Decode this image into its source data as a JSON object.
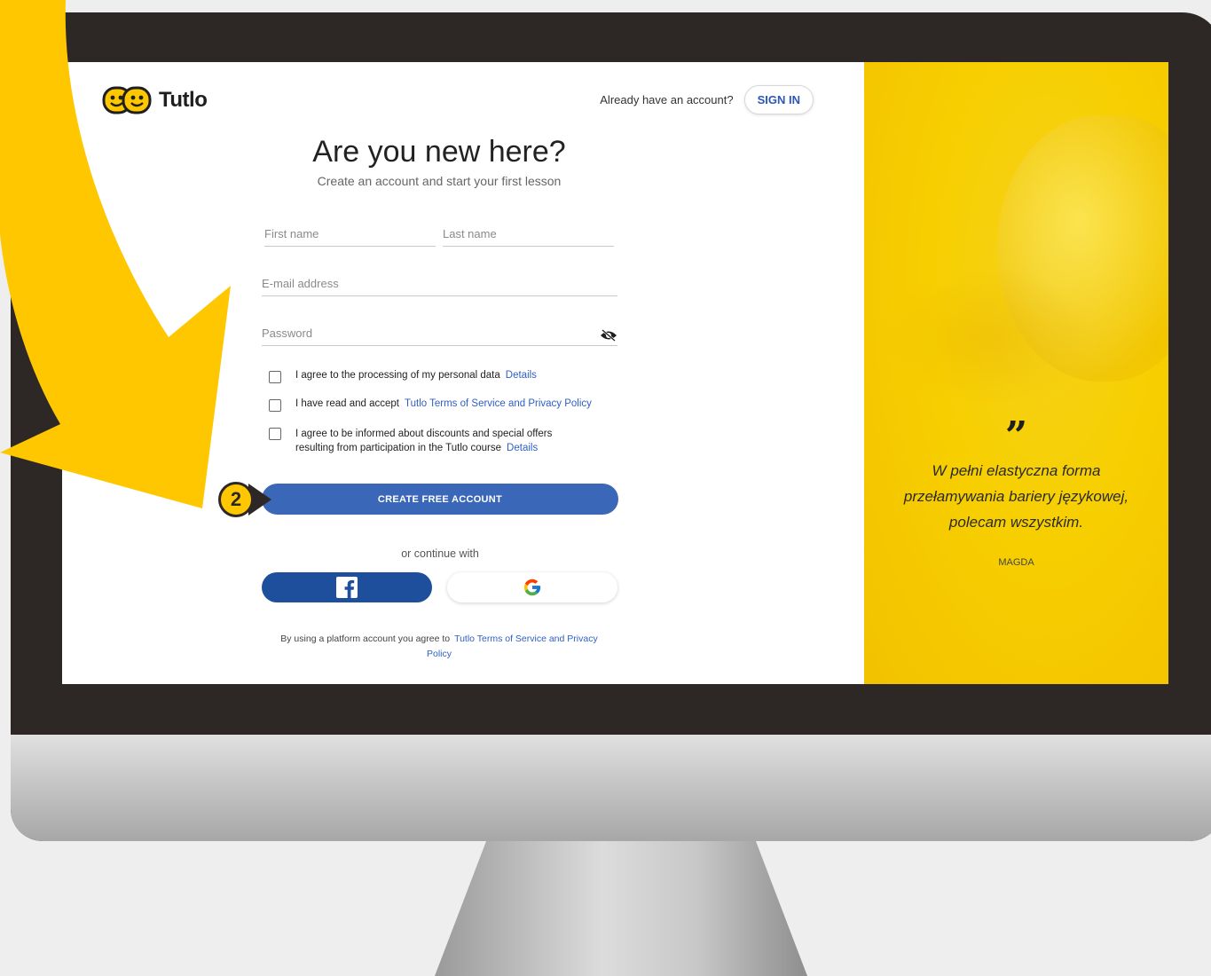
{
  "brand": {
    "name": "Tutlo"
  },
  "header": {
    "signin_prompt": "Already have an account?",
    "signin_label": "SIGN IN"
  },
  "form": {
    "title": "Are you new here?",
    "subtitle": "Create an account and start your first lesson",
    "first_name_placeholder": "First name",
    "last_name_placeholder": "Last name",
    "email_placeholder": "E-mail address",
    "password_placeholder": "Password",
    "consents": [
      {
        "text": "I agree to the processing of my personal data",
        "link": "Details"
      },
      {
        "text": "I have read and accept",
        "link": "Tutlo Terms of Service and Privacy Policy"
      },
      {
        "text": "I agree to be informed about discounts and special offers resulting from participation in the Tutlo course",
        "link": "Details"
      }
    ],
    "cta_label": "CREATE FREE ACCOUNT",
    "continue_with": "or continue with",
    "legal_text": "By using a platform account you agree to",
    "legal_link": "Tutlo Terms of Service and Privacy Policy"
  },
  "testimonial": {
    "mark": "”",
    "text": "W pełni elastyczna forma przełamywania bariery językowej, polecam wszystkim.",
    "author": "MAGDA"
  },
  "annotation": {
    "step_number": "2"
  },
  "colors": {
    "brand_yellow": "#f7cf00",
    "cta_blue": "#3b67b8",
    "facebook_blue": "#1d4f9c",
    "link_blue": "#2f5fc4",
    "bezel": "#2d2825"
  },
  "icons": {
    "logo": "tutlo-smiley-icon",
    "password_toggle": "eye-slash-icon",
    "facebook": "facebook-icon",
    "google": "google-icon"
  }
}
